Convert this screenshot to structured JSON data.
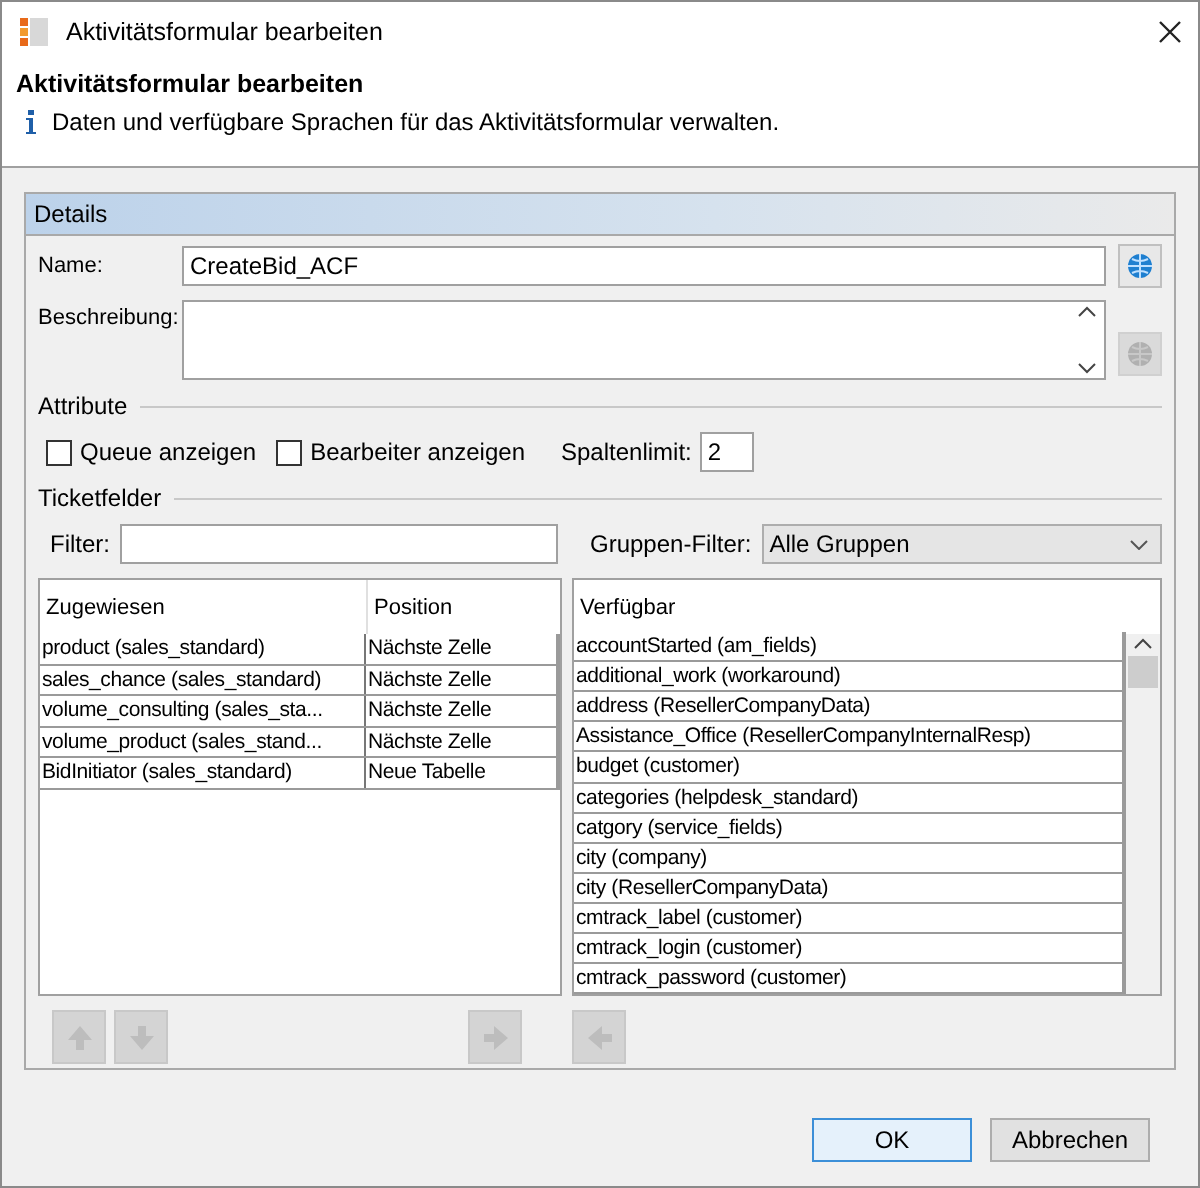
{
  "window": {
    "title": "Aktivitätsformular bearbeiten"
  },
  "header": {
    "title": "Aktivitätsformular bearbeiten",
    "info": "Daten und verfügbare Sprachen für das Aktivitätsformular verwalten."
  },
  "details": {
    "title": "Details",
    "name": {
      "label": "Name:",
      "value": "CreateBid_ACF"
    },
    "description": {
      "label": "Beschreibung:"
    },
    "side_buttons": [
      {
        "kind": "globe",
        "disabled": false
      },
      {
        "kind": "globe",
        "disabled": true
      }
    ],
    "attributes": {
      "title": "Attribute",
      "checkboxes": [
        {
          "label": "Queue anzeigen",
          "checked": false
        },
        {
          "label": "Bearbeiter anzeigen",
          "checked": false
        }
      ],
      "column_limit": {
        "label": "Spaltenlimit:",
        "value": "2"
      }
    },
    "ticket_fields": {
      "title": "Ticketfelder",
      "filter": {
        "label": "Filter:"
      },
      "group_filter": {
        "label": "Gruppen-Filter:",
        "value": "Alle Gruppen"
      },
      "assigned": {
        "columns": [
          "Zugewiesen",
          "Position"
        ],
        "rows": [
          [
            "product (sales_standard)",
            "Nächste Zelle"
          ],
          [
            "sales_chance (sales_standard)",
            "Nächste Zelle"
          ],
          [
            "volume_consulting (sales_sta...",
            "Nächste Zelle"
          ],
          [
            "volume_product (sales_stand...",
            "Nächste Zelle"
          ],
          [
            "BidInitiator (sales_standard)",
            "Neue Tabelle"
          ]
        ]
      },
      "available": {
        "columns": [
          "Verfügbar"
        ],
        "rows": [
          "accountStarted (am_fields)",
          "additional_work (workaround)",
          "address (ResellerCompanyData)",
          "Assistance_Office (ResellerCompanyInternalResp)",
          "budget (customer)",
          "categories (helpdesk_standard)",
          "catgory (service_fields)",
          "city (company)",
          "city (ResellerCompanyData)",
          "cmtrack_label (customer)",
          "cmtrack_login (customer)",
          "cmtrack_password (customer)"
        ]
      },
      "move_buttons": [
        {
          "kind": "up",
          "disabled": true
        },
        {
          "kind": "down",
          "disabled": true
        },
        {
          "kind": "right",
          "disabled": true
        },
        {
          "kind": "left",
          "disabled": true
        }
      ]
    }
  },
  "buttons": [
    {
      "label": "OK",
      "kind": "default"
    },
    {
      "label": "Abbrechen",
      "kind": "normal"
    }
  ]
}
